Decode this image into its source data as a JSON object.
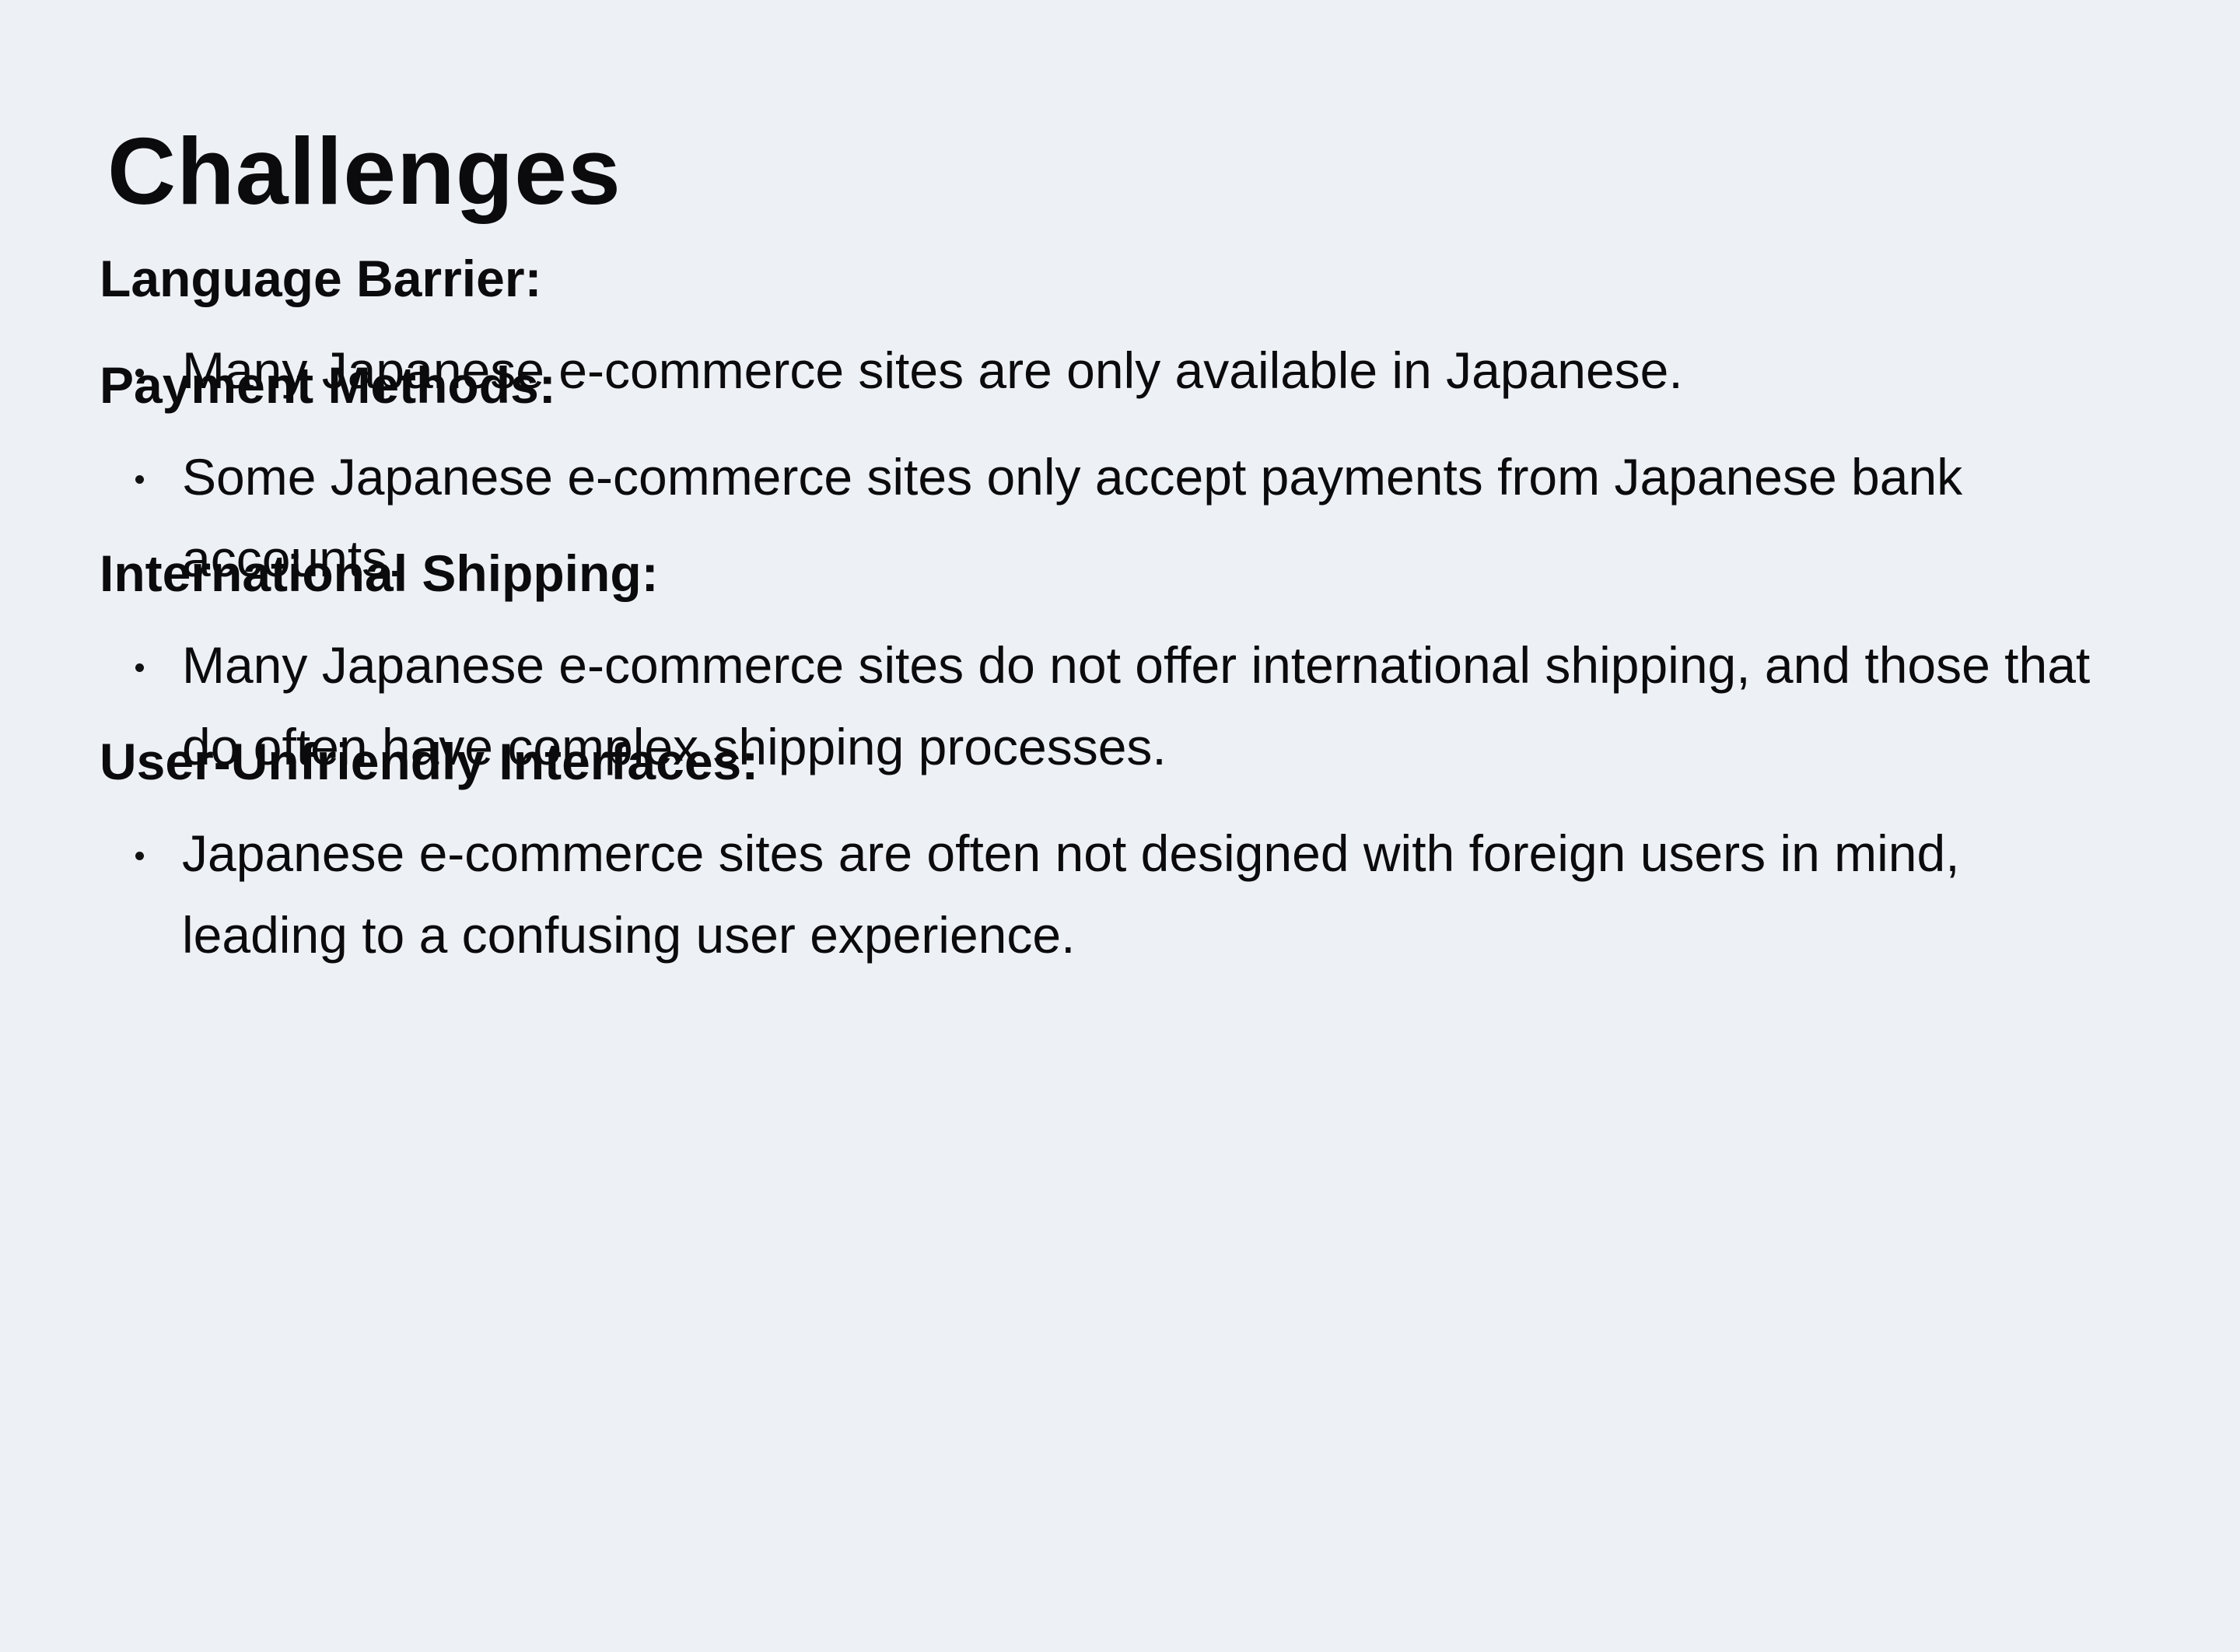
{
  "title": "Challenges",
  "sections": [
    {
      "heading": "Language Barrier:",
      "bullets": [
        "Many Japanese e-commerce sites are only available in Japanese."
      ]
    },
    {
      "heading": "Payment Methods:",
      "bullets": [
        "Some Japanese e-commerce sites only accept payments from Japanese bank accounts."
      ]
    },
    {
      "heading": "International Shipping:",
      "bullets": [
        "Many Japanese e-commerce sites do not offer international shipping, and those that do often have complex shipping processes."
      ]
    },
    {
      "heading": "User-Unfriendly Interfaces:",
      "bullets": [
        "Japanese e-commerce sites are often not designed with foreign users in mind, leading to a confusing user experience."
      ]
    }
  ]
}
